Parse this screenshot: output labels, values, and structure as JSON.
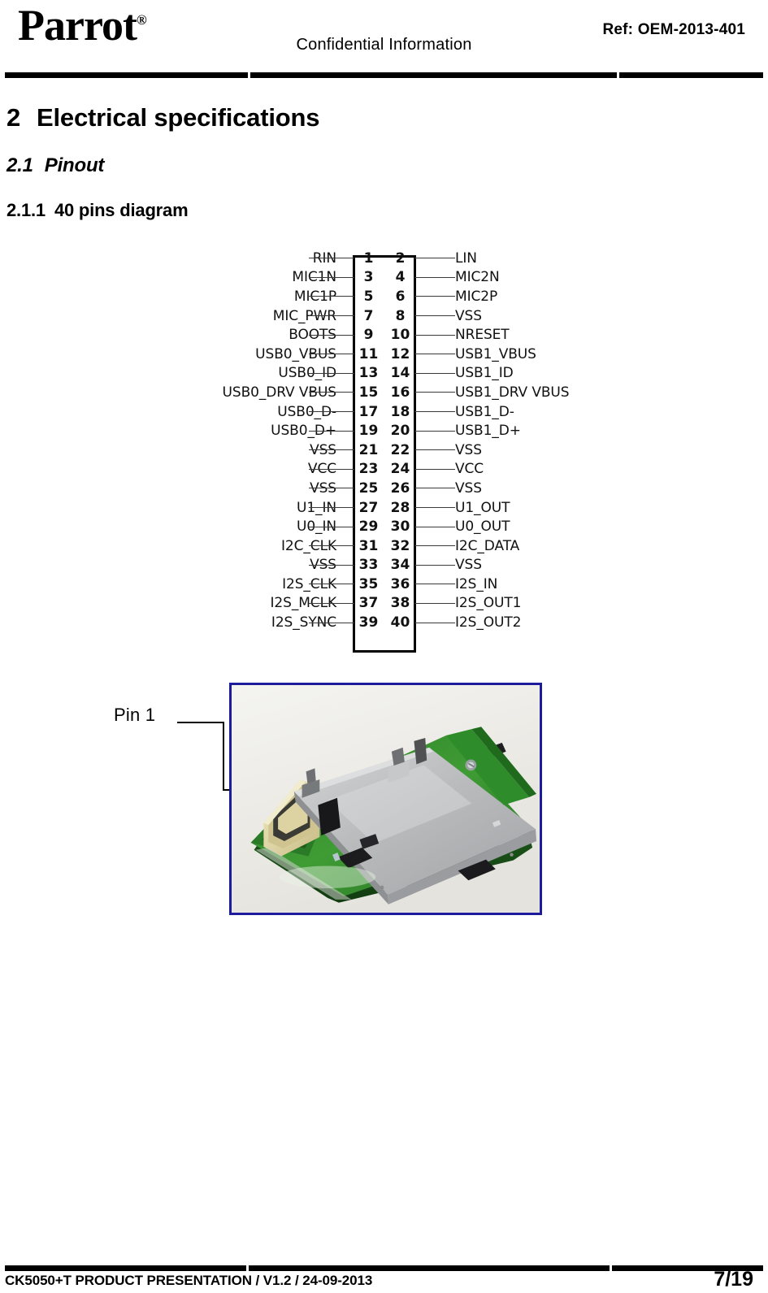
{
  "header": {
    "logo_text": "Parrot",
    "logo_mark": "®",
    "confidential": "Confidential Information",
    "ref": "Ref: OEM-2013-401"
  },
  "headings": {
    "h1_number": "2",
    "h1_title": "Electrical specifications",
    "h2_number": "2.1",
    "h2_title": "Pinout",
    "h3_number": "2.1.1",
    "h3_title": "40 pins diagram"
  },
  "pinout": {
    "total_pins": 40,
    "rows": [
      {
        "left_label": "RIN",
        "left_pin": "1",
        "right_pin": "2",
        "right_label": "LIN"
      },
      {
        "left_label": "MIC1N",
        "left_pin": "3",
        "right_pin": "4",
        "right_label": "MIC2N"
      },
      {
        "left_label": "MIC1P",
        "left_pin": "5",
        "right_pin": "6",
        "right_label": "MIC2P"
      },
      {
        "left_label": "MIC_PWR",
        "left_pin": "7",
        "right_pin": "8",
        "right_label": "VSS"
      },
      {
        "left_label": "BOOTS",
        "left_pin": "9",
        "right_pin": "10",
        "right_label": "NRESET"
      },
      {
        "left_label": "USB0_VBUS",
        "left_pin": "11",
        "right_pin": "12",
        "right_label": "USB1_VBUS"
      },
      {
        "left_label": "USB0_ID",
        "left_pin": "13",
        "right_pin": "14",
        "right_label": "USB1_ID"
      },
      {
        "left_label": "USB0_DRV VBUS",
        "left_pin": "15",
        "right_pin": "16",
        "right_label": "USB1_DRV VBUS"
      },
      {
        "left_label": "USB0_D-",
        "left_pin": "17",
        "right_pin": "18",
        "right_label": "USB1_D-"
      },
      {
        "left_label": "USB0_D+",
        "left_pin": "19",
        "right_pin": "20",
        "right_label": "USB1_D+"
      },
      {
        "left_label": "VSS",
        "left_pin": "21",
        "right_pin": "22",
        "right_label": "VSS"
      },
      {
        "left_label": "VCC",
        "left_pin": "23",
        "right_pin": "24",
        "right_label": "VCC"
      },
      {
        "left_label": "VSS",
        "left_pin": "25",
        "right_pin": "26",
        "right_label": "VSS"
      },
      {
        "left_label": "U1_IN",
        "left_pin": "27",
        "right_pin": "28",
        "right_label": "U1_OUT"
      },
      {
        "left_label": "U0_IN",
        "left_pin": "29",
        "right_pin": "30",
        "right_label": "U0_OUT"
      },
      {
        "left_label": "I2C_CLK",
        "left_pin": "31",
        "right_pin": "32",
        "right_label": "I2C_DATA"
      },
      {
        "left_label": "VSS",
        "left_pin": "33",
        "right_pin": "34",
        "right_label": "VSS"
      },
      {
        "left_label": "I2S_CLK",
        "left_pin": "35",
        "right_pin": "36",
        "right_label": "I2S_IN"
      },
      {
        "left_label": "I2S_MCLK",
        "left_pin": "37",
        "right_pin": "38",
        "right_label": "I2S_OUT1"
      },
      {
        "left_label": "I2S_SYNC",
        "left_pin": "39",
        "right_pin": "40",
        "right_label": "I2S_OUT2"
      }
    ]
  },
  "photo": {
    "annotation": "Pin 1",
    "border_color": "#1c1c9c",
    "description": "Photograph of CK5050+T module board with metal shield can and board-to-board connector"
  },
  "footer": {
    "left": "CK5050+T PRODUCT PRESENTATION / V1.2 / 24-09-2013",
    "page": "7/19"
  }
}
